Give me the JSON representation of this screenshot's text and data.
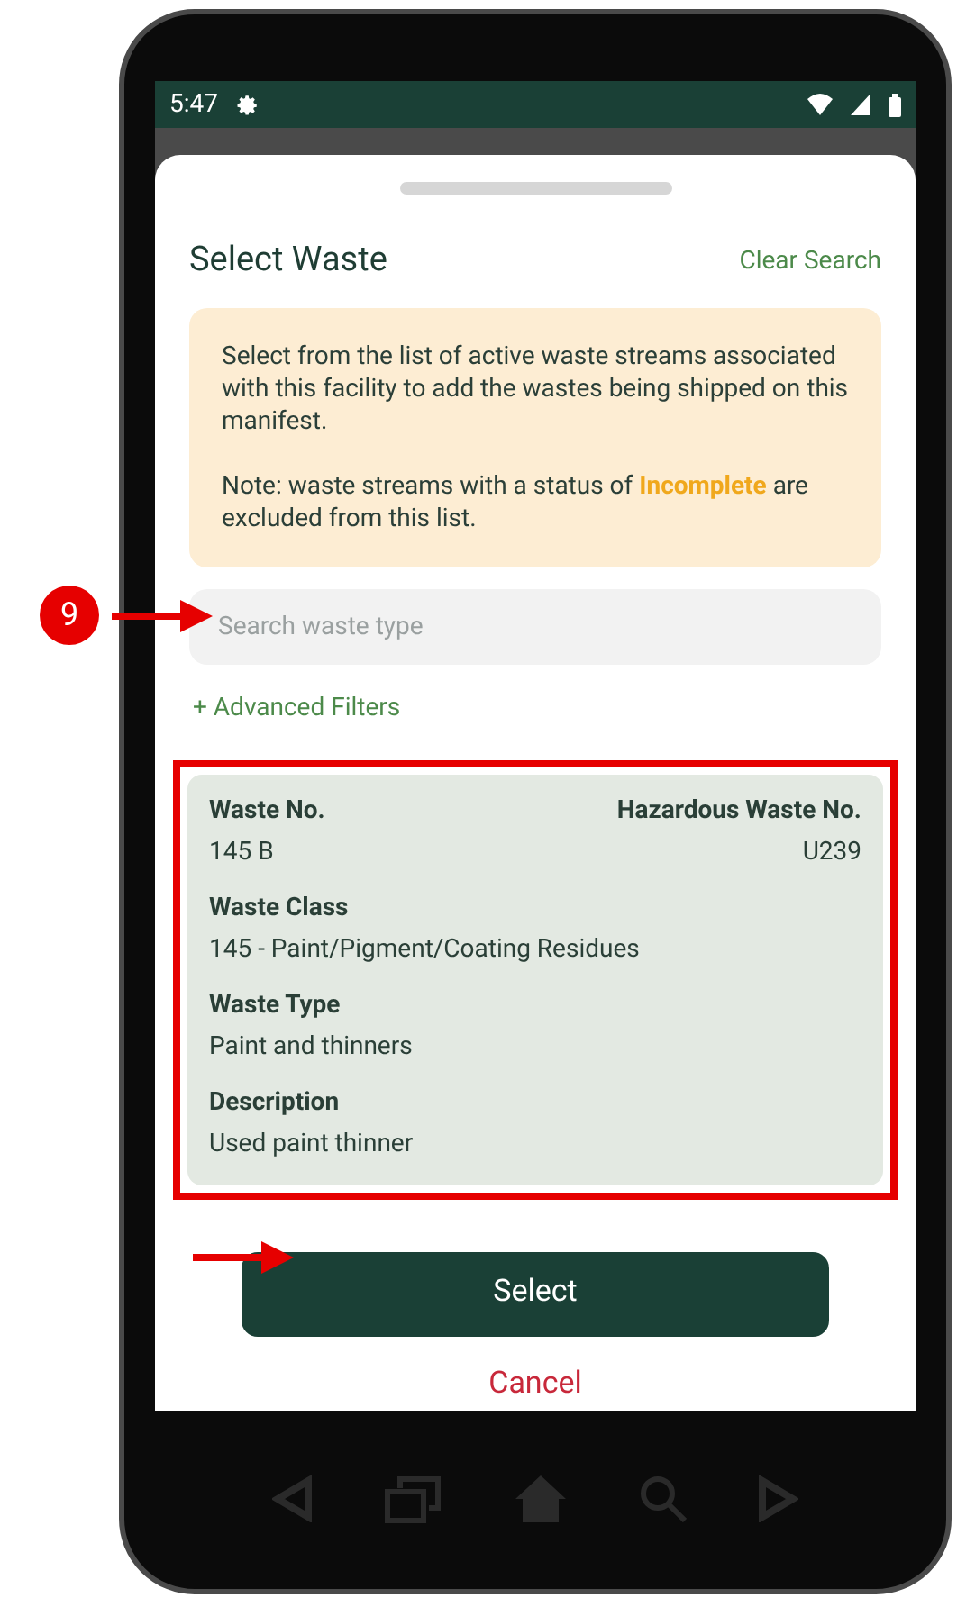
{
  "status_bar": {
    "time": "5:47"
  },
  "sheet": {
    "title": "Select Waste",
    "clear_search": "Clear Search",
    "info": [
      "Select from the list of active waste streams associated with this facility to add the wastes being shipped on this manifest.",
      "Note: waste streams with a status of **Incomplete** are excluded from this list."
    ],
    "search": {
      "placeholder": "Search waste type"
    },
    "advanced_filters": "+ Advanced Filters",
    "waste_card": {
      "selected": true,
      "top_fields": [
        {
          "label": "Waste No.",
          "value": "145 B"
        },
        {
          "label": "Hazardous Waste No.",
          "value": "U239"
        }
      ],
      "fields": [
        {
          "label": "Waste Class",
          "value": "145 - Paint/Pigment/Coating Residues"
        },
        {
          "label": "Waste Type",
          "value": "Paint and thinners"
        },
        {
          "label": "Description",
          "value": "Used paint thinner"
        }
      ]
    },
    "select_button": "Select",
    "cancel_button": "Cancel"
  },
  "annotation": {
    "step": "9"
  }
}
